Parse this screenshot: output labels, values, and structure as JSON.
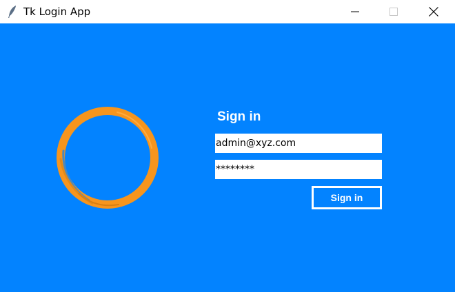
{
  "window": {
    "title": "Tk Login App",
    "controls": [
      "minimize-icon",
      "maximize-icon",
      "close-icon"
    ]
  },
  "colors": {
    "background": "#0383ff",
    "accent": "#f7951d",
    "text": "#ffffff"
  },
  "login": {
    "heading": "Sign in",
    "email_value": "admin@xyz.com",
    "password_value": "********",
    "button_label": "Sign in"
  }
}
